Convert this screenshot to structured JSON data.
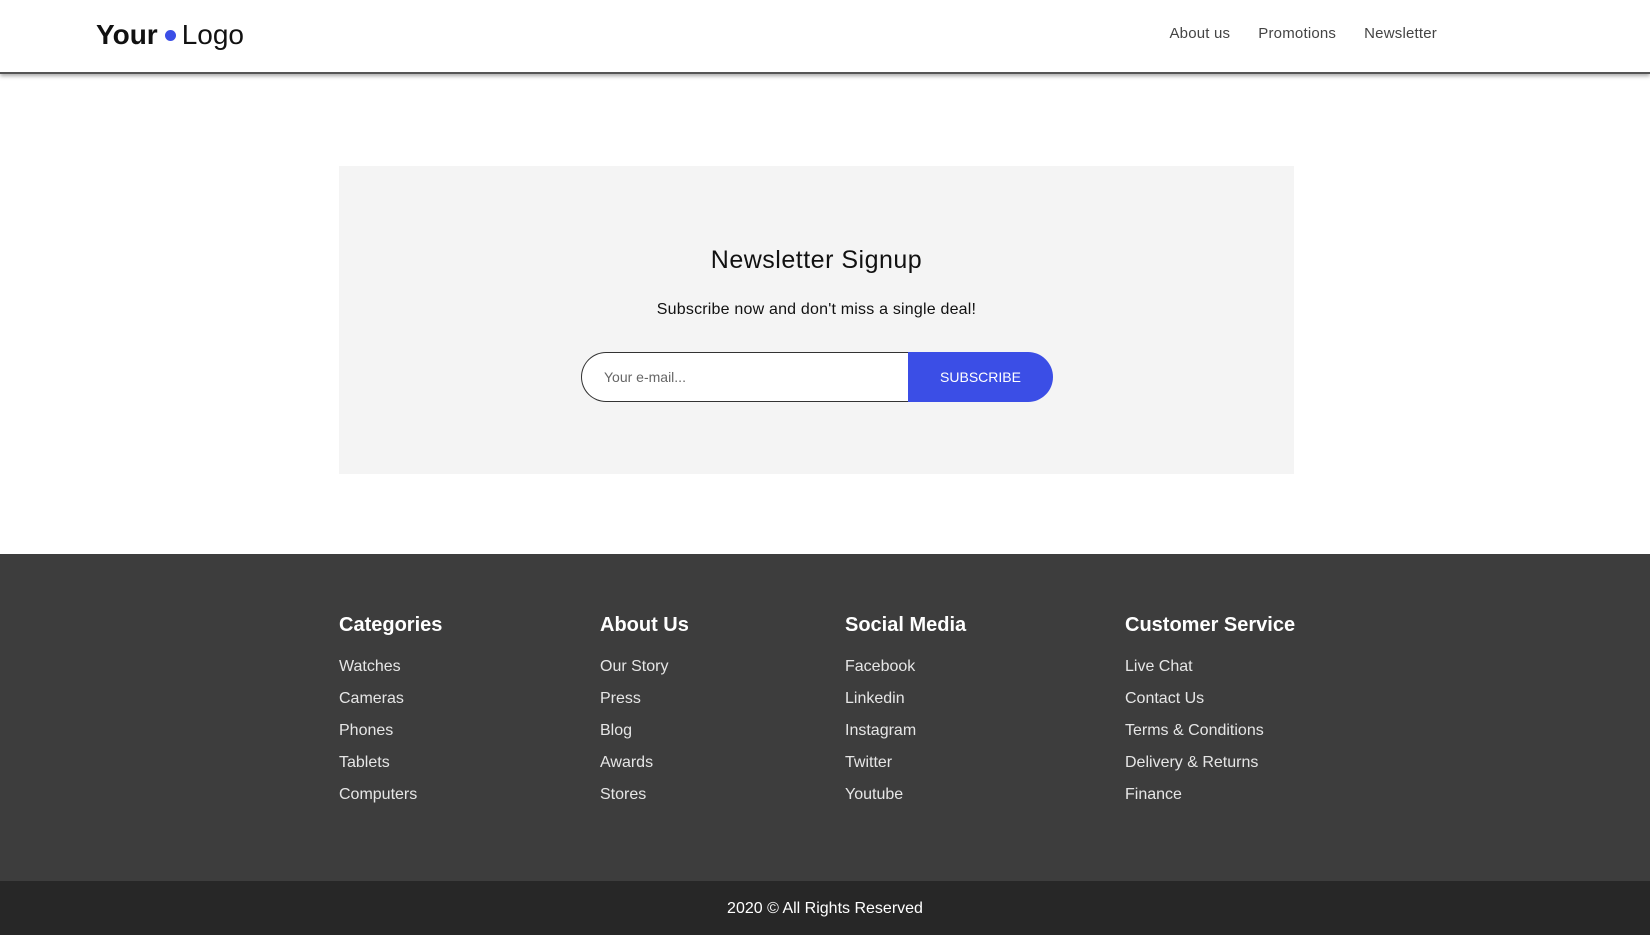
{
  "colors": {
    "accent": "#3b4ee6",
    "footer_bg": "#3d3d3d",
    "bottom_bar_bg": "#272727",
    "signup_bg": "#f4f4f4"
  },
  "header": {
    "logo_bold": "Your",
    "logo_text": "Logo",
    "nav": [
      "About us",
      "Promotions",
      "Newsletter"
    ]
  },
  "signup": {
    "title": "Newsletter Signup",
    "subtitle": "Subscribe now and don't miss a single deal!",
    "email_placeholder": "Your e-mail...",
    "email_value": "",
    "button_label": "SUBSCRIBE"
  },
  "footer": {
    "columns": [
      {
        "title": "Categories",
        "items": [
          "Watches",
          "Cameras",
          "Phones",
          "Tablets",
          "Computers"
        ]
      },
      {
        "title": "About Us",
        "items": [
          "Our Story",
          "Press",
          "Blog",
          "Awards",
          "Stores"
        ]
      },
      {
        "title": "Social Media",
        "items": [
          "Facebook",
          "Linkedin",
          "Instagram",
          "Twitter",
          "Youtube"
        ]
      },
      {
        "title": "Customer Service",
        "items": [
          "Live Chat",
          "Contact Us",
          "Terms & Conditions",
          "Delivery & Returns",
          "Finance"
        ]
      }
    ],
    "copyright": "2020 © All Rights Reserved"
  }
}
